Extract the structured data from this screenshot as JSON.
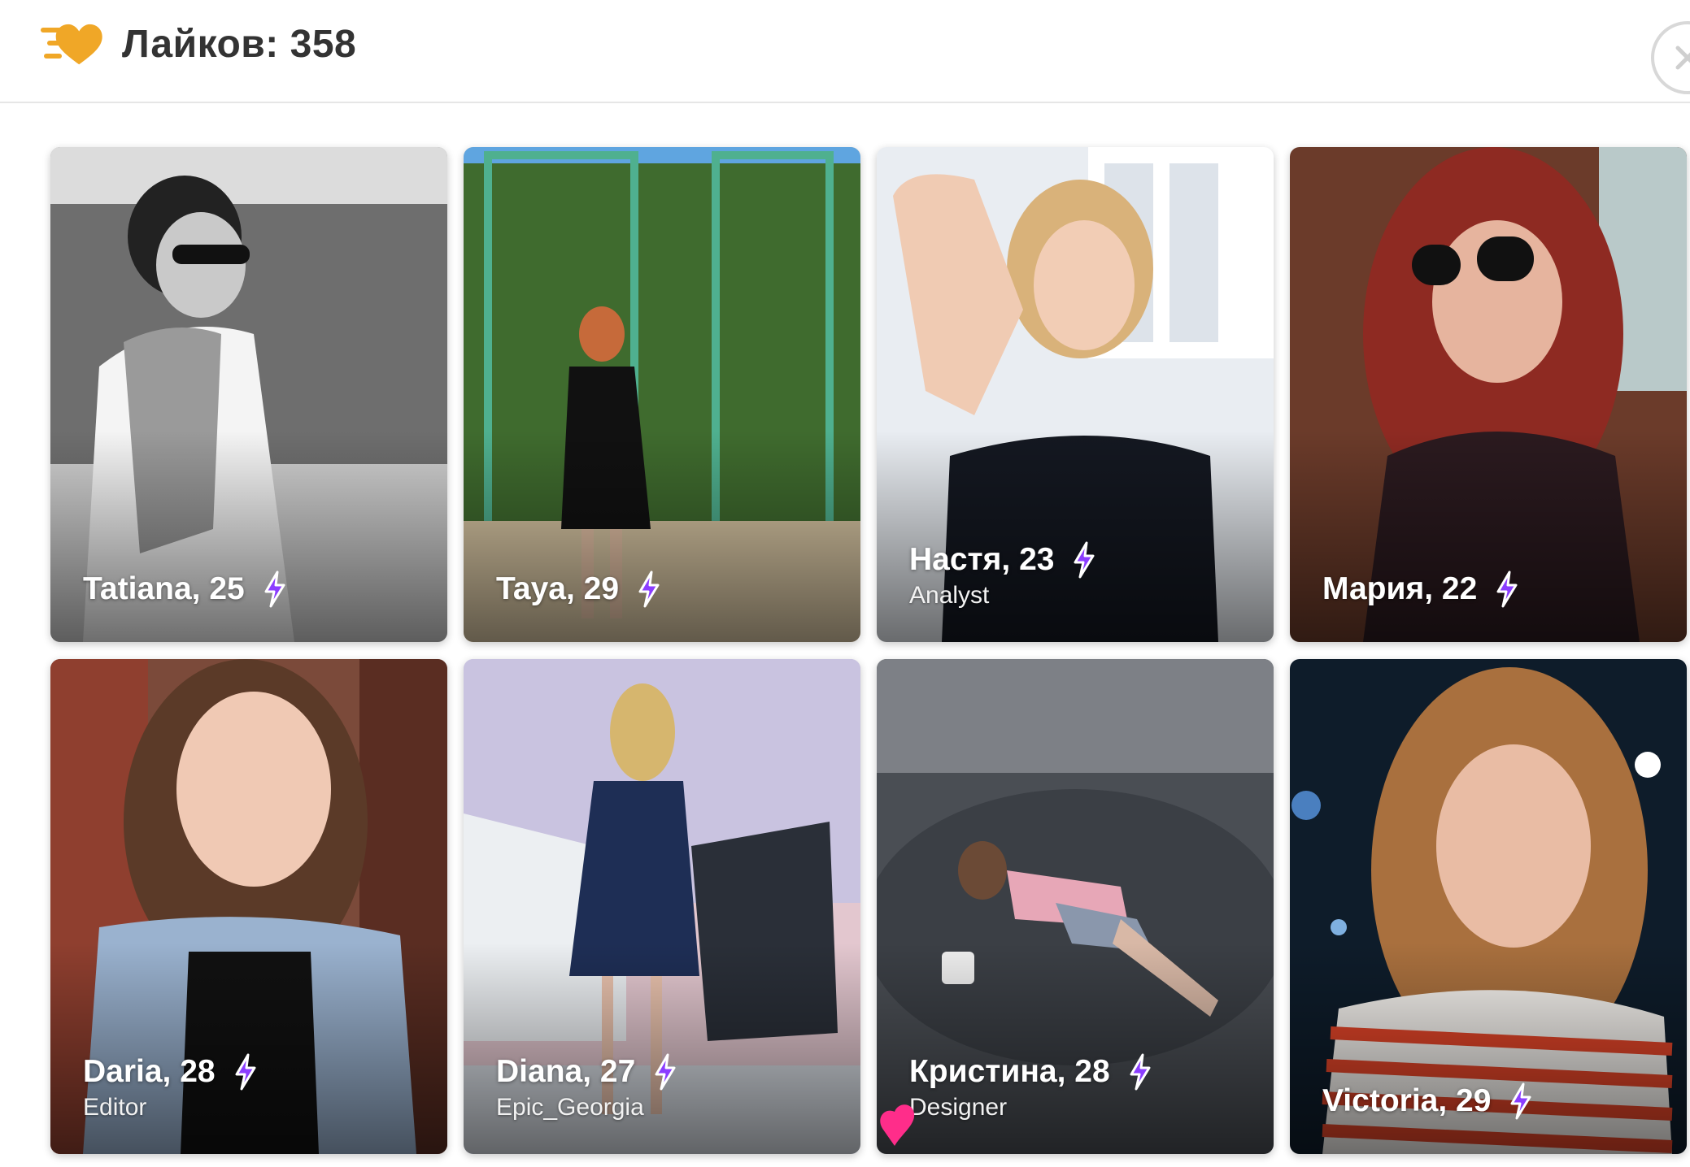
{
  "header": {
    "title": "Лайков: 358",
    "logo_icon": "likes-heart-icon",
    "close_icon": "close-icon"
  },
  "colors": {
    "accent_gold": "#f0a727",
    "bolt_purple": "#8b3dff",
    "heart_pink": "#ff2d8a"
  },
  "cards": [
    {
      "name": "Tatiana, 25",
      "subtitle": "",
      "grayscale": true
    },
    {
      "name": "Taya, 29",
      "subtitle": ""
    },
    {
      "name": "Настя, 23",
      "subtitle": "Analyst"
    },
    {
      "name": "Мария, 22",
      "subtitle": ""
    },
    {
      "name": "Daria, 28",
      "subtitle": "Editor"
    },
    {
      "name": "Diana, 27",
      "subtitle": "Epic_Georgia"
    },
    {
      "name": "Кристина, 28",
      "subtitle": "Designer",
      "super_like": true
    },
    {
      "name": "Victoria, 29",
      "subtitle": ""
    }
  ]
}
